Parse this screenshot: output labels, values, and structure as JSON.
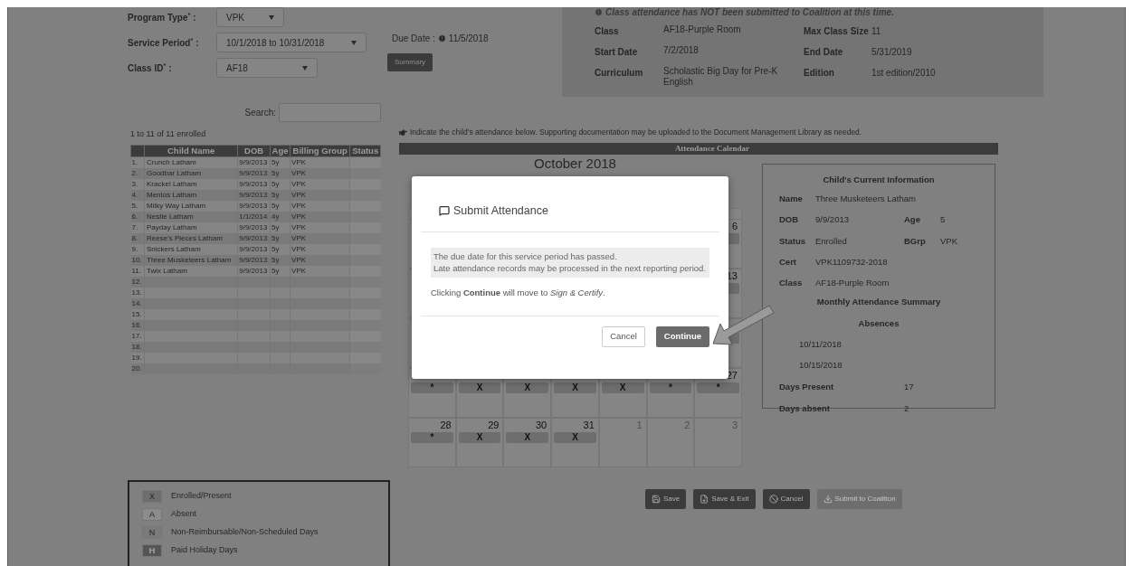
{
  "form": {
    "fields": [
      {
        "label": "Program Type$^{*}$ :",
        "value": "VPK"
      },
      {
        "label": "Service Period$^{*}$ :",
        "value": "10/1/2018 to 10/31/2018"
      },
      {
        "label": "Class ID$^{*}$ :",
        "value": "AF18"
      }
    ],
    "due_label": "Due Date :",
    "due_value": "11/5/2018",
    "summary_button": "Summary"
  },
  "class_panel": {
    "notice": "Class attendance has NOT been submitted to Coalition at this time.",
    "rows": [
      {
        "label": "Class",
        "value": "AF18-Purple Room",
        "label2": "Max Class Size",
        "value2": "11"
      },
      {
        "label": "Start Date",
        "value": "7/2/2018",
        "label2": "End Date",
        "value2": "5/31/2019"
      },
      {
        "label": "Curriculum",
        "value": "Scholastic Big Day for Pre-K English",
        "label2": "Edition",
        "value2": "1st edition/2010"
      }
    ]
  },
  "roster": {
    "search_label": "Search:",
    "count": "1 to 11 of 11 enrolled",
    "columns": [
      "Child Name",
      "DOB",
      "Age",
      "Billing Group",
      "Status"
    ],
    "rows": [
      {
        "num": "1.",
        "name": "Crunch Latham",
        "dob": "9/9/2013",
        "age": "5y",
        "group": "VPK"
      },
      {
        "num": "2.",
        "name": "Goodbar Latham",
        "dob": "9/9/2013",
        "age": "5y",
        "group": "VPK"
      },
      {
        "num": "3.",
        "name": "Krackel Latham",
        "dob": "9/9/2013",
        "age": "5y",
        "group": "VPK"
      },
      {
        "num": "4.",
        "name": "Mentos Latham",
        "dob": "9/9/2013",
        "age": "5y",
        "group": "VPK"
      },
      {
        "num": "5.",
        "name": "Milky Way Latham",
        "dob": "9/9/2013",
        "age": "5y",
        "group": "VPK"
      },
      {
        "num": "6.",
        "name": "Nestle Latham",
        "dob": "1/1/2014",
        "age": "4y",
        "group": "VPK"
      },
      {
        "num": "7.",
        "name": "Payday Latham",
        "dob": "9/9/2013",
        "age": "5y",
        "group": "VPK"
      },
      {
        "num": "8.",
        "name": "Reese's Pieces Latham",
        "dob": "9/9/2013",
        "age": "5y",
        "group": "VPK"
      },
      {
        "num": "9.",
        "name": "Snickers Latham",
        "dob": "9/9/2013",
        "age": "5y",
        "group": "VPK"
      },
      {
        "num": "10.",
        "name": "Three Musketeers Latham",
        "dob": "9/9/2013",
        "age": "5y",
        "group": "VPK"
      },
      {
        "num": "11.",
        "name": "Twix Latham",
        "dob": "9/9/2013",
        "age": "5y",
        "group": "VPK"
      },
      {
        "num": "12."
      },
      {
        "num": "13."
      },
      {
        "num": "14."
      },
      {
        "num": "15."
      },
      {
        "num": "16."
      },
      {
        "num": "17."
      },
      {
        "num": "18."
      },
      {
        "num": "19."
      },
      {
        "num": "20."
      }
    ]
  },
  "instruction": "Indicate the child's attendance below. Supporting documentation may be uploaded to the Document Management Library as needed.",
  "calendar": {
    "bar_title": "Attendance Calendar",
    "title": "October 2018",
    "weeks": [
      {
        "cells": [
          {},
          {},
          {},
          {},
          {},
          {},
          {
            "day": "6",
            "bar": true
          }
        ]
      },
      {
        "cells": [
          {},
          {},
          {},
          {},
          {},
          {},
          {
            "day": "13",
            "bar": true
          }
        ]
      },
      {
        "cells": [
          {},
          {},
          {},
          {},
          {},
          {},
          {
            "bar": true
          }
        ]
      },
      {
        "cells": [
          {
            "bar": true,
            "mark": "*"
          },
          {
            "bar": true,
            "mark": "X"
          },
          {
            "bar": true,
            "mark": "X"
          },
          {
            "bar": true,
            "mark": "X"
          },
          {
            "bar": true,
            "mark": "X"
          },
          {
            "bar": true,
            "mark": "*"
          },
          {
            "day": "27",
            "bar": true,
            "mark": "*"
          }
        ]
      },
      {
        "cells": [
          {
            "day": "28",
            "bar": true,
            "mark": "*"
          },
          {
            "day": "29",
            "bar": true,
            "mark": "X"
          },
          {
            "day": "30",
            "bar": true,
            "mark": "X"
          },
          {
            "day": "31",
            "bar": true,
            "mark": "X"
          },
          {
            "day": "1",
            "outside": true
          },
          {
            "day": "2",
            "outside": true
          },
          {
            "day": "3",
            "outside": true
          }
        ]
      }
    ]
  },
  "child_info": {
    "title": "Child's Current Information",
    "rows": [
      {
        "label": "Name",
        "value": "Three Musketeers Latham"
      },
      {
        "label": "DOB",
        "value": "9/9/2013",
        "label2": "Age",
        "value2": "5"
      },
      {
        "label": "Status",
        "value": "Enrolled",
        "label2": "BGrp",
        "value2": "VPK"
      },
      {
        "label": "Cert",
        "value": "VPK1109732-2018"
      },
      {
        "label": "Class",
        "value": "AF18-Purple Room"
      }
    ],
    "summary_title": "Monthly Attendance Summary",
    "absences_title": "Absences",
    "absences": [
      "10/11/2018",
      "10/15/2018"
    ],
    "totals": [
      {
        "label": "Days Present",
        "value": "17"
      },
      {
        "label": "Days absent",
        "value": "2"
      }
    ]
  },
  "legend": [
    {
      "key": "X",
      "label": "Enrolled/Present",
      "color": "#6e6e6e"
    },
    {
      "key": "A",
      "label": "Absent",
      "color": "#8c8c8c"
    },
    {
      "key": "N",
      "label": "Non-Reimbursable/Non-Scheduled Days",
      "color": "#7a7a7a"
    },
    {
      "key": "H",
      "label": "Paid Holiday Days",
      "color": "#555555"
    }
  ],
  "actions": [
    {
      "kind": "save",
      "label": "Save",
      "disabled": false
    },
    {
      "kind": "save_exit",
      "label": "Save & Exit",
      "disabled": false
    },
    {
      "kind": "cancel",
      "label": "Cancel",
      "disabled": false
    },
    {
      "kind": "submit",
      "label": "Submit to Coalition",
      "disabled": true
    }
  ],
  "modal": {
    "title": "Submit Attendance",
    "notice_lines": [
      "The due date for this service period has passed.",
      "Late attendance records may be processed in the next reporting period."
    ],
    "message": "Clicking **Continue** will move to *Sign & Certify*.",
    "cancel": "Cancel",
    "continue": "Continue"
  }
}
